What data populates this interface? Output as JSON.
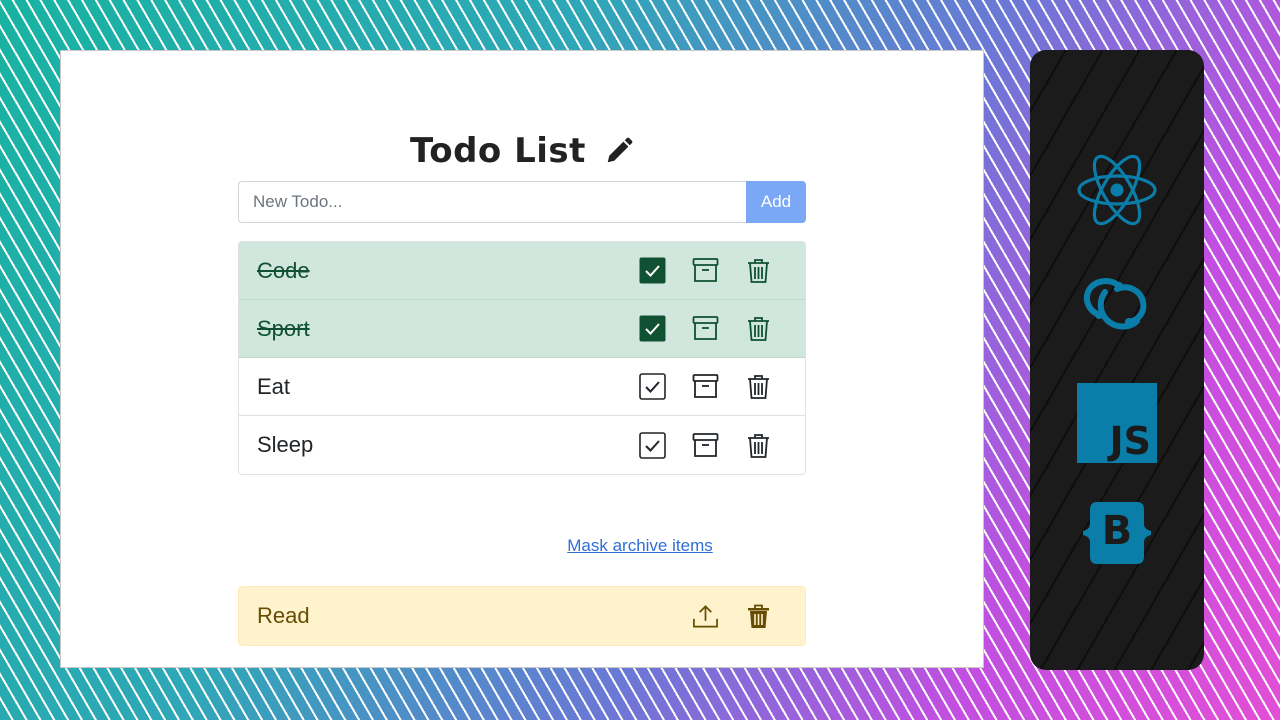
{
  "header": {
    "title": "Todo List",
    "title_icon": "pencil-icon"
  },
  "new_todo": {
    "placeholder": "New Todo...",
    "value": "",
    "add_label": "Add",
    "add_color": "#7ba7f7"
  },
  "todos": [
    {
      "label": "Code",
      "done": true
    },
    {
      "label": "Sport",
      "done": true
    },
    {
      "label": "Eat",
      "done": false
    },
    {
      "label": "Sleep",
      "done": false
    }
  ],
  "mask_archive_label": "Mask archive items",
  "archived": [
    {
      "label": "Read"
    }
  ],
  "sidebar": {
    "background": "#1b1b1b",
    "accent": "#0a7ea9",
    "techs": [
      {
        "icon": "react-icon"
      },
      {
        "icon": "redux-icon"
      },
      {
        "icon": "javascript-icon",
        "text": "JS"
      },
      {
        "icon": "bootstrap-icon",
        "text": "B"
      }
    ]
  },
  "colors": {
    "done_bg": "#d1e7dd",
    "done_text": "#0f5132",
    "archive_bg": "#fff3cd",
    "archive_text": "#664d03",
    "link": "#2f6fd6"
  }
}
